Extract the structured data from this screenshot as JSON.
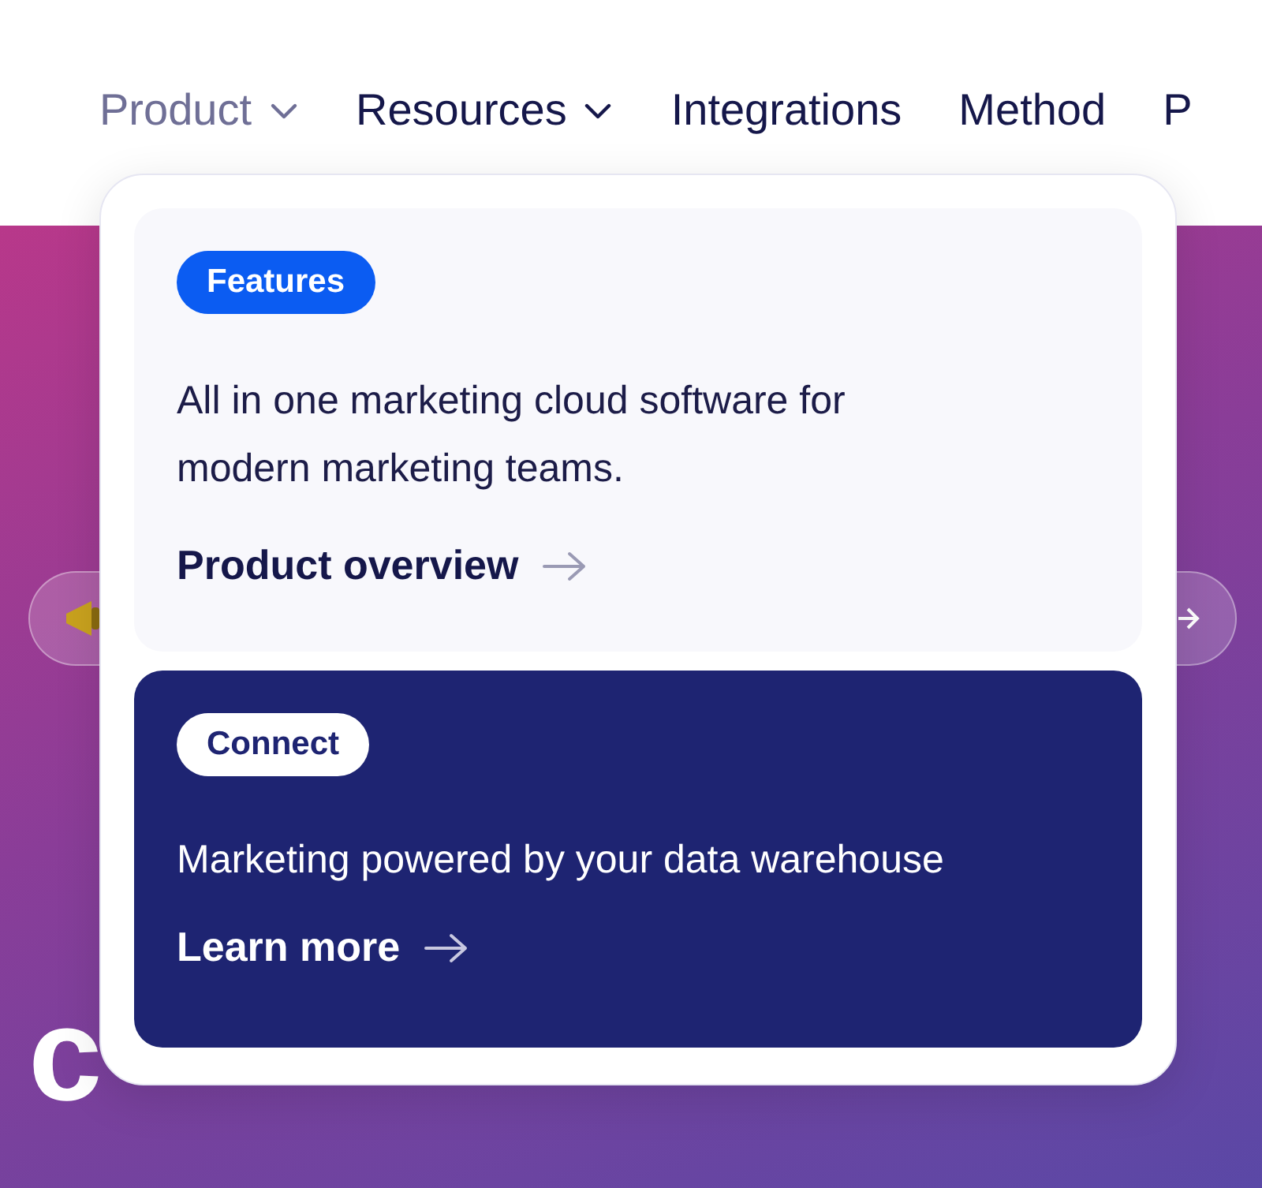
{
  "nav": {
    "items": [
      {
        "label": "Product",
        "dropdown": true,
        "selected": true
      },
      {
        "label": "Resources",
        "dropdown": true,
        "selected": false
      },
      {
        "label": "Integrations",
        "dropdown": false,
        "selected": false
      },
      {
        "label": "Method",
        "dropdown": false,
        "selected": false
      },
      {
        "label": "P",
        "dropdown": false,
        "selected": false
      }
    ]
  },
  "menu": {
    "cards": [
      {
        "kind": "light",
        "badge": "Features",
        "description": "All in one marketing cloud software for modern marketing teams.",
        "link": "Product overview"
      },
      {
        "kind": "dark",
        "badge": "Connect",
        "description": "Marketing powered by your data warehouse",
        "link": "Learn more"
      }
    ]
  },
  "hero": {
    "heading_line_2_start": "c"
  }
}
